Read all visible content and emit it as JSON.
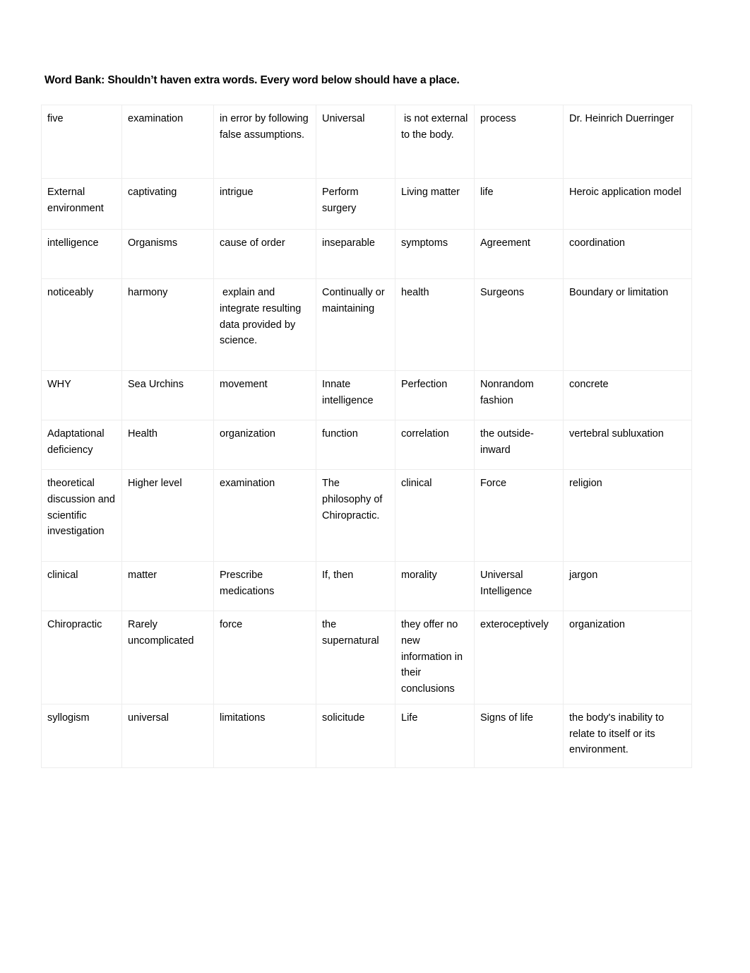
{
  "document": {
    "heading": "Word Bank: Shouldn’t haven extra words. Every word below should have a place."
  },
  "word_bank": {
    "columns": 7,
    "rows": [
      [
        "five",
        "examination",
        "in error by following false assumptions.",
        "Universal",
        " is not external to the body.",
        "process",
        "Dr. Heinrich Duerringer"
      ],
      [
        "External environment",
        "captivating",
        "intrigue",
        "Perform surgery",
        "Living matter",
        "life",
        "Heroic application model"
      ],
      [
        "intelligence",
        "Organisms",
        "cause of order",
        "inseparable",
        "symptoms",
        "Agreement",
        "coordination"
      ],
      [
        "noticeably",
        "harmony",
        " explain and integrate resulting data provided by science.",
        "Continually or maintaining",
        "health",
        "Surgeons",
        "Boundary or limitation"
      ],
      [
        "WHY",
        "Sea Urchins",
        "movement",
        "Innate intelligence",
        "Perfection",
        "Nonrandom fashion",
        "concrete"
      ],
      [
        "Adaptational deficiency",
        "Health",
        "organization",
        "function",
        "correlation",
        "the outside-inward",
        "vertebral subluxation"
      ],
      [
        "theoretical discussion and scientific investigation",
        "Higher level",
        "examination",
        "The philosophy of Chiropractic.",
        "clinical",
        "Force",
        "religion"
      ],
      [
        "clinical",
        "matter",
        "Prescribe medications",
        "If, then",
        "morality",
        "Universal Intelligence",
        "jargon"
      ],
      [
        "Chiropractic",
        "Rarely uncomplicated",
        "force",
        "the supernatural",
        "they offer no new information in their conclusions",
        "exteroceptively",
        "organization"
      ],
      [
        "syllogism",
        "universal",
        "limitations",
        "solicitude",
        "Life",
        "Signs of life",
        "the body's inability to relate to itself or its environment."
      ]
    ]
  },
  "style": {
    "page_background": "#ffffff",
    "text_color": "#000000",
    "cell_border_color": "#ededed"
  }
}
